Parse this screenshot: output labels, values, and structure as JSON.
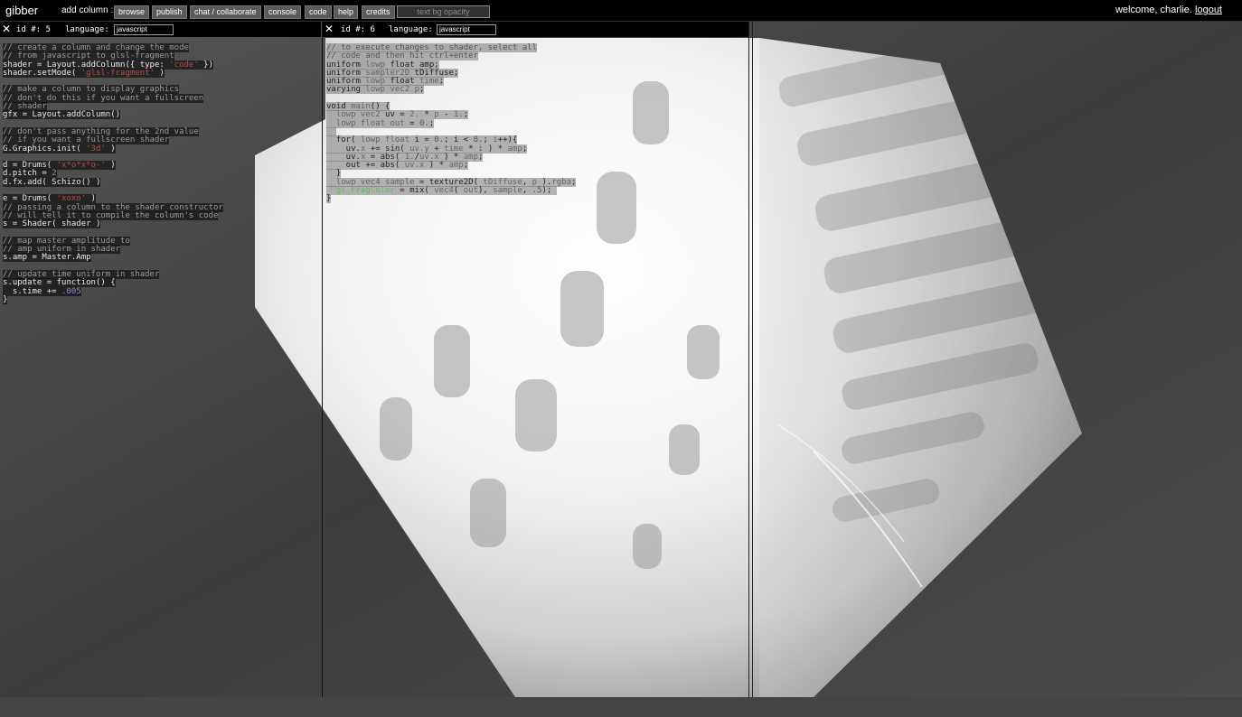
{
  "app": {
    "title": "gibber",
    "add_column_label": "add column :",
    "menu": [
      "browse",
      "publish",
      "chat / collaborate",
      "console",
      "code",
      "help",
      "credits"
    ],
    "opacity_slider_label": "text bg opacity",
    "welcome_text": "welcome, charlie.",
    "logout_label": "logout"
  },
  "columns": [
    {
      "close_label": "✕",
      "id_label": "id #: 5",
      "language_label": "language:",
      "language_value": "javascript",
      "code_lines": [
        [
          [
            "c",
            "// create a column and change the mode"
          ]
        ],
        [
          [
            "c",
            "// from javascript to glsl-fragment"
          ]
        ],
        [
          [
            "t",
            "shader = Layout.addColumn({ type: "
          ],
          [
            "s",
            "'code'"
          ],
          [
            "t",
            " })"
          ]
        ],
        [
          [
            "t",
            "shader.setMode( "
          ],
          [
            "s",
            "'glsl-fragment'"
          ],
          [
            "t",
            " )"
          ]
        ],
        [],
        [
          [
            "c",
            "// make a column to display graphics"
          ]
        ],
        [
          [
            "c",
            "// don't do this if you want a fullscreen"
          ]
        ],
        [
          [
            "c",
            "// shader"
          ]
        ],
        [
          [
            "t",
            "gfx = Layout.addColumn()"
          ]
        ],
        [],
        [
          [
            "c",
            "// don't pass anything for the 2nd value"
          ]
        ],
        [
          [
            "c",
            "// if you want a fullscreen shader"
          ]
        ],
        [
          [
            "t",
            "G.Graphics.init( "
          ],
          [
            "s",
            "'3d'"
          ],
          [
            "t",
            " )"
          ]
        ],
        [],
        [
          [
            "t",
            "d = Drums( "
          ],
          [
            "s",
            "'x*o*x*o-'"
          ],
          [
            "t",
            " )"
          ]
        ],
        [
          [
            "t",
            "d.pitch = "
          ],
          [
            "n",
            "2"
          ]
        ],
        [
          [
            "t",
            "d.fx.add( Schizo() )"
          ]
        ],
        [],
        [
          [
            "t",
            "e = Drums( "
          ],
          [
            "s",
            "'xoxo'"
          ],
          [
            "t",
            " )"
          ]
        ],
        [
          [
            "c",
            "// passing a column to the shader constructor"
          ]
        ],
        [
          [
            "c",
            "// will tell it to compile the column's code"
          ]
        ],
        [
          [
            "t",
            "s = Shader( shader )"
          ]
        ],
        [],
        [
          [
            "c",
            "// map master amplitude to"
          ]
        ],
        [
          [
            "c",
            "// amp uniform in shader"
          ]
        ],
        [
          [
            "t",
            "s.amp = Master.Amp"
          ]
        ],
        [],
        [
          [
            "c",
            "// update time uniform in shader"
          ]
        ],
        [
          [
            "t",
            "s.update = function() {"
          ]
        ],
        [
          [
            "t",
            "  s.time += "
          ],
          [
            "n",
            ".005"
          ]
        ],
        [
          [
            "t",
            "}"
          ]
        ]
      ]
    },
    {
      "close_label": "✕",
      "id_label": "id #: 6",
      "language_label": "language:",
      "language_value": "javascript",
      "code_lines": [
        [
          [
            "c",
            "// to execute changes to shader, select all"
          ]
        ],
        [
          [
            "c",
            "// code and then hit ctrl+enter"
          ]
        ],
        [
          [
            "t",
            "uniform "
          ],
          [
            "k",
            "lowp"
          ],
          [
            "t",
            " float amp;"
          ]
        ],
        [
          [
            "t",
            "uniform "
          ],
          [
            "k",
            "sampler2D"
          ],
          [
            "t",
            " tDiffuse;"
          ]
        ],
        [
          [
            "t",
            "uniform "
          ],
          [
            "k",
            "lowp"
          ],
          [
            "t",
            " float "
          ],
          [
            "k",
            "time"
          ],
          [
            "t",
            ";"
          ]
        ],
        [
          [
            "t",
            "varying "
          ],
          [
            "k",
            "lowp vec2"
          ],
          [
            "t",
            " "
          ],
          [
            "k",
            "p"
          ],
          [
            "t",
            ";"
          ]
        ],
        [],
        [
          [
            "t",
            "void "
          ],
          [
            "k",
            "main"
          ],
          [
            "t",
            "() {"
          ]
        ],
        [
          [
            "t",
            "  "
          ],
          [
            "k",
            "lowp vec2"
          ],
          [
            "t",
            " uv = "
          ],
          [
            "k",
            "2."
          ],
          [
            "t",
            " * "
          ],
          [
            "k",
            "p"
          ],
          [
            "t",
            " - "
          ],
          [
            "k",
            "1."
          ],
          [
            "t",
            ";"
          ]
        ],
        [
          [
            "t",
            "  "
          ],
          [
            "k",
            "lowp float"
          ],
          [
            "t",
            " "
          ],
          [
            "k",
            "out"
          ],
          [
            "t",
            " = "
          ],
          [
            "n",
            "0."
          ],
          [
            "t",
            ";"
          ]
        ],
        [
          [
            "t",
            "  "
          ]
        ],
        [
          [
            "t",
            "  for( "
          ],
          [
            "k",
            "lowp float"
          ],
          [
            "t",
            " i = "
          ],
          [
            "n",
            "0."
          ],
          [
            "t",
            "; i < "
          ],
          [
            "n",
            "8."
          ],
          [
            "t",
            "; "
          ],
          [
            "k",
            "i"
          ],
          [
            "t",
            "++){"
          ]
        ],
        [
          [
            "t",
            "    uv."
          ],
          [
            "k",
            "x"
          ],
          [
            "t",
            " += sin( "
          ],
          [
            "k",
            "uv.y"
          ],
          [
            "t",
            " + "
          ],
          [
            "k",
            "time"
          ],
          [
            "t",
            " * "
          ],
          [
            "k",
            "i"
          ],
          [
            "t",
            " ) * "
          ],
          [
            "k",
            "amp"
          ],
          [
            "t",
            ";"
          ]
        ],
        [
          [
            "t",
            "    uv."
          ],
          [
            "k",
            "x"
          ],
          [
            "t",
            " = abs( "
          ],
          [
            "k",
            "1."
          ],
          [
            "t",
            "/"
          ],
          [
            "k",
            "uv.x"
          ],
          [
            "t",
            " ) * "
          ],
          [
            "k",
            "amp"
          ],
          [
            "t",
            ";"
          ]
        ],
        [
          [
            "t",
            "    out += abs( "
          ],
          [
            "k",
            "uv.x"
          ],
          [
            "t",
            " ) * "
          ],
          [
            "k",
            "amp"
          ],
          [
            "t",
            ";"
          ]
        ],
        [
          [
            "t",
            "  }"
          ]
        ],
        [
          [
            "t",
            "  "
          ],
          [
            "k",
            "lowp vec4"
          ],
          [
            "t",
            " "
          ],
          [
            "k",
            "sample"
          ],
          [
            "t",
            " = texture2D( "
          ],
          [
            "k",
            "tDiffuse"
          ],
          [
            "t",
            ", "
          ],
          [
            "k",
            "p"
          ],
          [
            "t",
            " )."
          ],
          [
            "k",
            "rgba"
          ],
          [
            "t",
            ";"
          ]
        ],
        [
          [
            "t",
            "  "
          ],
          [
            "g",
            "gl_FragColor"
          ],
          [
            "t",
            " = mix( "
          ],
          [
            "k",
            "vec4"
          ],
          [
            "t",
            "( "
          ],
          [
            "k",
            "out"
          ],
          [
            "t",
            "), "
          ],
          [
            "k",
            "sample"
          ],
          [
            "t",
            ", "
          ],
          [
            "n",
            ".5"
          ],
          [
            "t",
            "); "
          ]
        ],
        [
          [
            "t",
            "}"
          ]
        ]
      ]
    }
  ],
  "colors": {
    "topbar_bg": "#000000",
    "menu_button_bg": "#5a5a5a",
    "string_color": "#b84a4a",
    "number_color": "#8c8cc8",
    "comment_color": "#9a9a9a",
    "gl_fragcolor": "#66b866"
  }
}
